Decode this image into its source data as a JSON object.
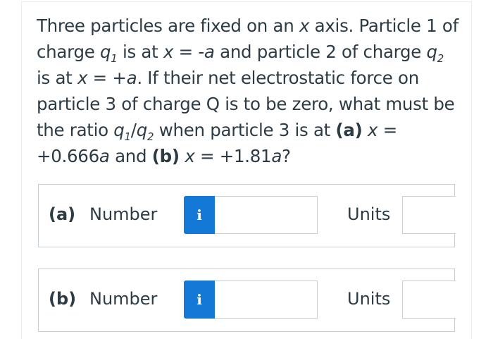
{
  "question": {
    "t1": "Three particles are fixed on an ",
    "x1": "x",
    "t2": " axis. Particle 1 of charge ",
    "q1": "q",
    "s1": "1",
    "t3": " is at ",
    "x2": "x",
    "t4": " = -",
    "a1": "a",
    "t5": " and particle 2 of charge ",
    "q2": "q",
    "s2": "2",
    "t6": " is at ",
    "x3": "x",
    "t7": " = +",
    "a2": "a",
    "t8": ". If their net electrostatic force on particle 3 of charge Q is to be zero, what must be the ratio ",
    "q3": "q",
    "s3": "1",
    "t9": "/",
    "q4": "q",
    "s4": "2",
    "t10": " when particle 3 is at ",
    "pa": "(a)",
    "t11": " ",
    "x4": "x",
    "t12": " = +0.666",
    "a3": "a",
    "t13": " and ",
    "pb": "(b)",
    "t14": " ",
    "x5": "x",
    "t15": " = +1.81",
    "a4": "a",
    "t16": "?"
  },
  "answers": [
    {
      "part_label": "(a)",
      "number_label": "Number",
      "info_icon": "i",
      "number_value": "",
      "units_label": "Units",
      "units_value": ""
    },
    {
      "part_label": "(b)",
      "number_label": "Number",
      "info_icon": "i",
      "number_value": "",
      "units_label": "Units",
      "units_value": ""
    }
  ],
  "colors": {
    "text": "#2d3b45",
    "info_button": "#1378d6",
    "border": "#c7cdd1"
  }
}
